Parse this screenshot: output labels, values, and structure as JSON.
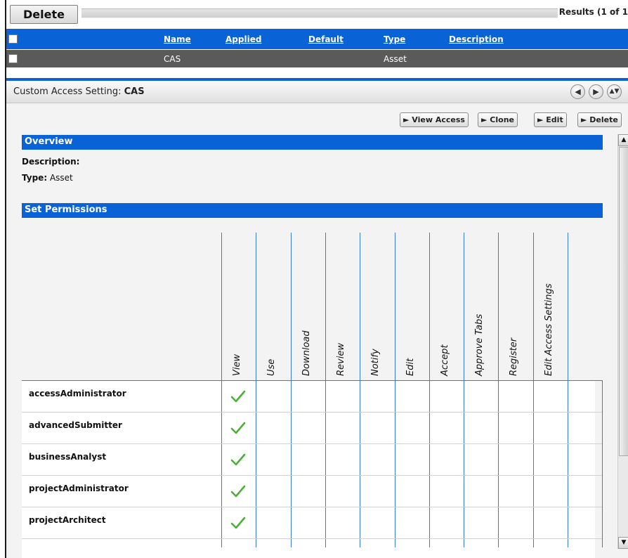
{
  "toolbar": {
    "delete_label": "Delete",
    "results_text": "Results (1 of 1"
  },
  "results_table": {
    "columns": [
      "Name",
      "Applied",
      "Default",
      "Type",
      "Description"
    ],
    "row": {
      "name": "CAS",
      "applied": "",
      "default": "",
      "type": "Asset",
      "description": ""
    }
  },
  "panel": {
    "title_prefix": "Custom Access Setting: ",
    "title_name": "CAS",
    "nav_icons": [
      "prev-icon",
      "next-icon",
      "collapse-icon"
    ],
    "actions": [
      "► View Access",
      "► Clone",
      "► Edit",
      "► Delete"
    ]
  },
  "overview": {
    "heading": "Overview",
    "description_label": "Description:",
    "description_value": "",
    "type_label": "Type:",
    "type_value": " Asset"
  },
  "permissions": {
    "heading": "Set Permissions",
    "columns": [
      "View",
      "Use",
      "Download",
      "Review",
      "Notify",
      "Edit",
      "Accept",
      "Approve Tabs",
      "Register",
      "Edit Access Settings"
    ],
    "roles": [
      {
        "name": "accessAdministrator",
        "granted": [
          "View"
        ]
      },
      {
        "name": "advancedSubmitter",
        "granted": [
          "View"
        ]
      },
      {
        "name": "businessAnalyst",
        "granted": [
          "View"
        ]
      },
      {
        "name": "projectAdministrator",
        "granted": [
          "View"
        ]
      },
      {
        "name": "projectArchitect",
        "granted": [
          "View"
        ]
      }
    ]
  },
  "colors": {
    "header_blue": "#0a63d6",
    "selected_row_gray": "#5a5a5a",
    "check_green": "#4caf3a",
    "grid_line_blue": "#3a7bd5"
  }
}
